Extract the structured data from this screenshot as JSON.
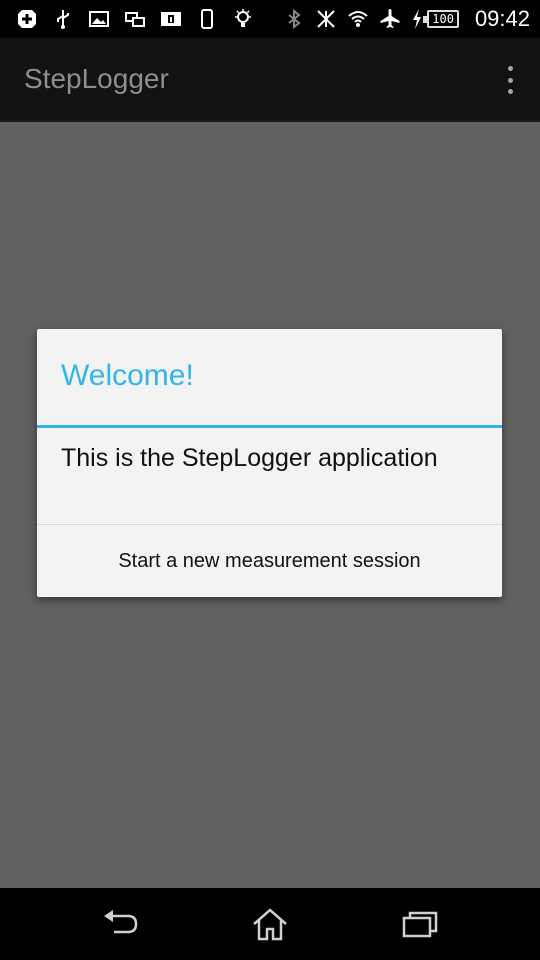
{
  "status_bar": {
    "icons": [
      "add-icon",
      "usb-icon",
      "image-icon",
      "screens-icon",
      "info-card-icon",
      "phone-icon",
      "bulb-icon",
      "bluetooth-icon",
      "signal-off-icon",
      "wifi-icon",
      "airplane-icon",
      "charging-icon"
    ],
    "battery_level": "100",
    "time": "09:42"
  },
  "action_bar": {
    "title": "StepLogger",
    "overflow_icon": "more-vert-icon"
  },
  "dialog": {
    "title": "Welcome!",
    "message": "This is the StepLogger application",
    "button_label": "Start a new measurement session",
    "accent_color": "#33b5e5"
  },
  "nav_bar": {
    "icons": [
      "back-icon",
      "home-icon",
      "recents-icon"
    ]
  }
}
